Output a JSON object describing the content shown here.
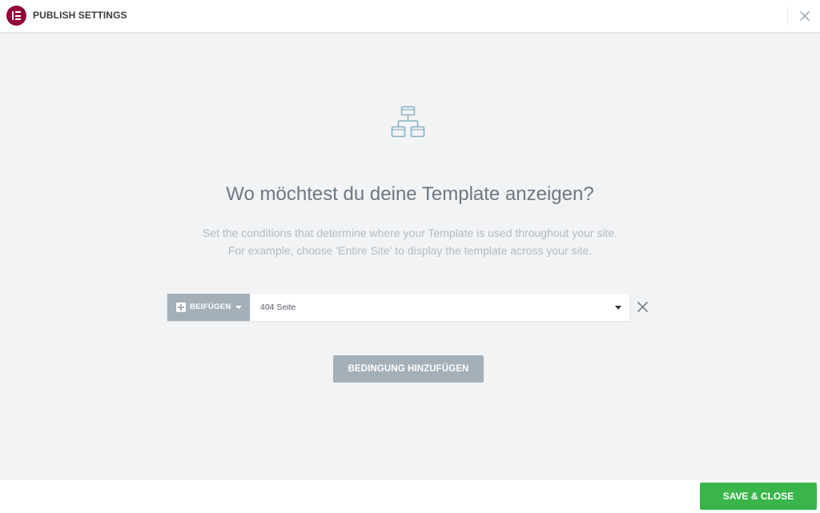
{
  "header": {
    "title": "PUBLISH SETTINGS",
    "logo_icon": "elementor-logo-icon",
    "close_icon": "close-icon"
  },
  "main": {
    "icon": "sitemap-icon",
    "title": "Wo möchtest du deine Template anzeigen?",
    "description_lines": [
      "Set the conditions that determine where your Template is used throughout your site.",
      "For example, choose 'Entire Site' to display the template across your site."
    ]
  },
  "condition": {
    "type_label": "BEIFÜGEN",
    "type_icon": "plus-square-icon",
    "selected_value": "404 Seite",
    "remove_icon": "close-icon"
  },
  "add_condition_label": "BEDINGUNG HINZUFÜGEN",
  "footer": {
    "save_label": "SAVE & CLOSE"
  },
  "colors": {
    "brand": "#92003b",
    "save": "#39b54a",
    "neutral_button": "#a4afb7",
    "background": "#f1f3f5",
    "title_text": "#6d7882",
    "description_text": "#b4bbc1"
  }
}
